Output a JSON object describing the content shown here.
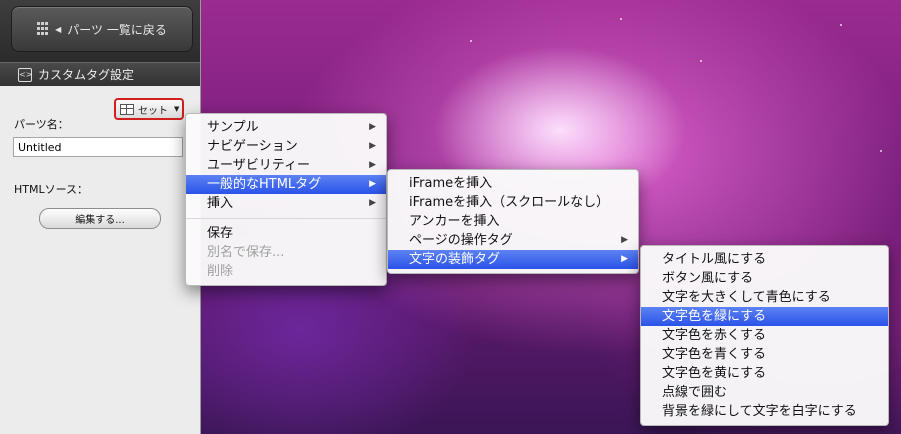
{
  "sidebar": {
    "back_button": "パーツ 一覧に戻る",
    "section_title": "カスタムタグ設定",
    "set_button": "セット",
    "parts_name_label": "パーツ名：",
    "parts_name_value": "Untitled",
    "html_source_label": "HTMLソース：",
    "edit_button": "編集する..."
  },
  "menu1": {
    "items": [
      {
        "label": "サンプル"
      },
      {
        "label": "ナビゲーション"
      },
      {
        "label": "ユーザビリティー"
      },
      {
        "label": "一般的なHTMLタグ"
      },
      {
        "label": "挿入"
      },
      {
        "label": "保存"
      },
      {
        "label": "別名で保存..."
      },
      {
        "label": "削除"
      }
    ]
  },
  "menu2": {
    "items": [
      {
        "label": "iFrameを挿入"
      },
      {
        "label": "iFrameを挿入（スクロールなし）"
      },
      {
        "label": "アンカーを挿入"
      },
      {
        "label": "ページの操作タグ"
      },
      {
        "label": "文字の装飾タグ"
      }
    ]
  },
  "menu3": {
    "items": [
      {
        "label": "タイトル風にする"
      },
      {
        "label": "ボタン風にする"
      },
      {
        "label": "文字を大きくして青色にする"
      },
      {
        "label": "文字色を緑にする"
      },
      {
        "label": "文字色を赤くする"
      },
      {
        "label": "文字色を青くする"
      },
      {
        "label": "文字色を黄にする"
      },
      {
        "label": "点線で囲む"
      },
      {
        "label": "背景を緑にして文字を白字にする"
      }
    ]
  },
  "colors": {
    "selection": "#2a53e8",
    "highlight_border": "#d0201d",
    "sidebar_bg": "#ececec"
  }
}
